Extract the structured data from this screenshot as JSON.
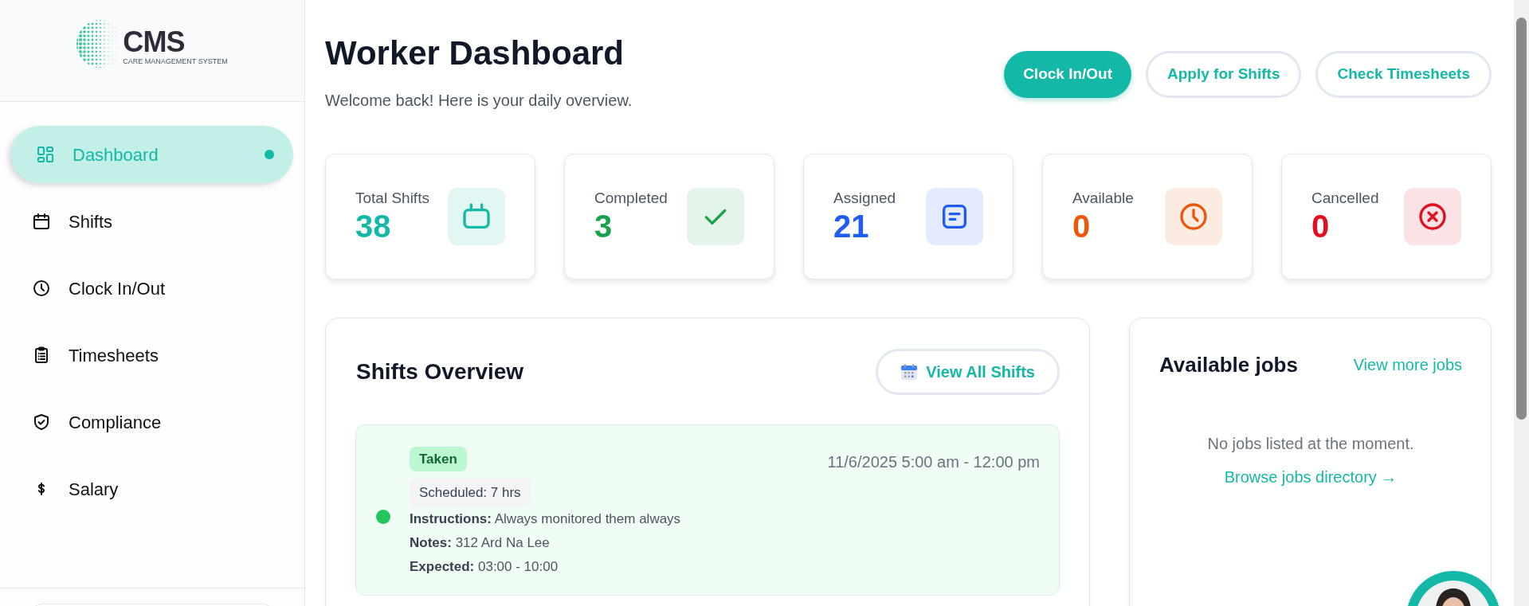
{
  "logo": {
    "name": "CMS",
    "tagline": "CARE MANAGEMENT SYSTEM"
  },
  "sidebar": {
    "items": [
      {
        "label": "Dashboard",
        "selected": true
      },
      {
        "label": "Shifts",
        "selected": false
      },
      {
        "label": "Clock In/Out",
        "selected": false
      },
      {
        "label": "Timesheets",
        "selected": false
      },
      {
        "label": "Compliance",
        "selected": false
      },
      {
        "label": "Salary",
        "selected": false
      }
    ]
  },
  "header": {
    "title": "Worker Dashboard",
    "subtitle": "Welcome back! Here is your daily overview.",
    "buttons": [
      {
        "label": "Clock In/Out",
        "kind": "primary"
      },
      {
        "label": "Apply for Shifts",
        "kind": "outline"
      },
      {
        "label": "Check Timesheets",
        "kind": "outline"
      }
    ]
  },
  "stats": [
    {
      "label": "Total Shifts",
      "value": "38",
      "color": "#14b8a6"
    },
    {
      "label": "Completed",
      "value": "3",
      "color": "#16a34a"
    },
    {
      "label": "Assigned",
      "value": "21",
      "color": "#1d5cf5"
    },
    {
      "label": "Available",
      "value": "0",
      "color": "#ea580c"
    },
    {
      "label": "Cancelled",
      "value": "0",
      "color": "#e0101e"
    }
  ],
  "shifts_overview": {
    "title": "Shifts Overview",
    "button": "View All Shifts",
    "shifts": [
      {
        "status": "Taken",
        "schedule": "Scheduled: 7 hrs",
        "time": "11/6/2025 5:00 am - 12:00 pm",
        "color": "#22c55e",
        "details": [
          "**Instructions:** Always monitored them always",
          "**Notes:** 312 Ard Na Lee",
          "**Expected:** 03:00 - 10:00"
        ]
      }
    ]
  },
  "jobs": {
    "title": "Available jobs",
    "link": "View more jobs",
    "empty": "No jobs listed at the moment.",
    "browse": "Browse jobs directory →"
  }
}
